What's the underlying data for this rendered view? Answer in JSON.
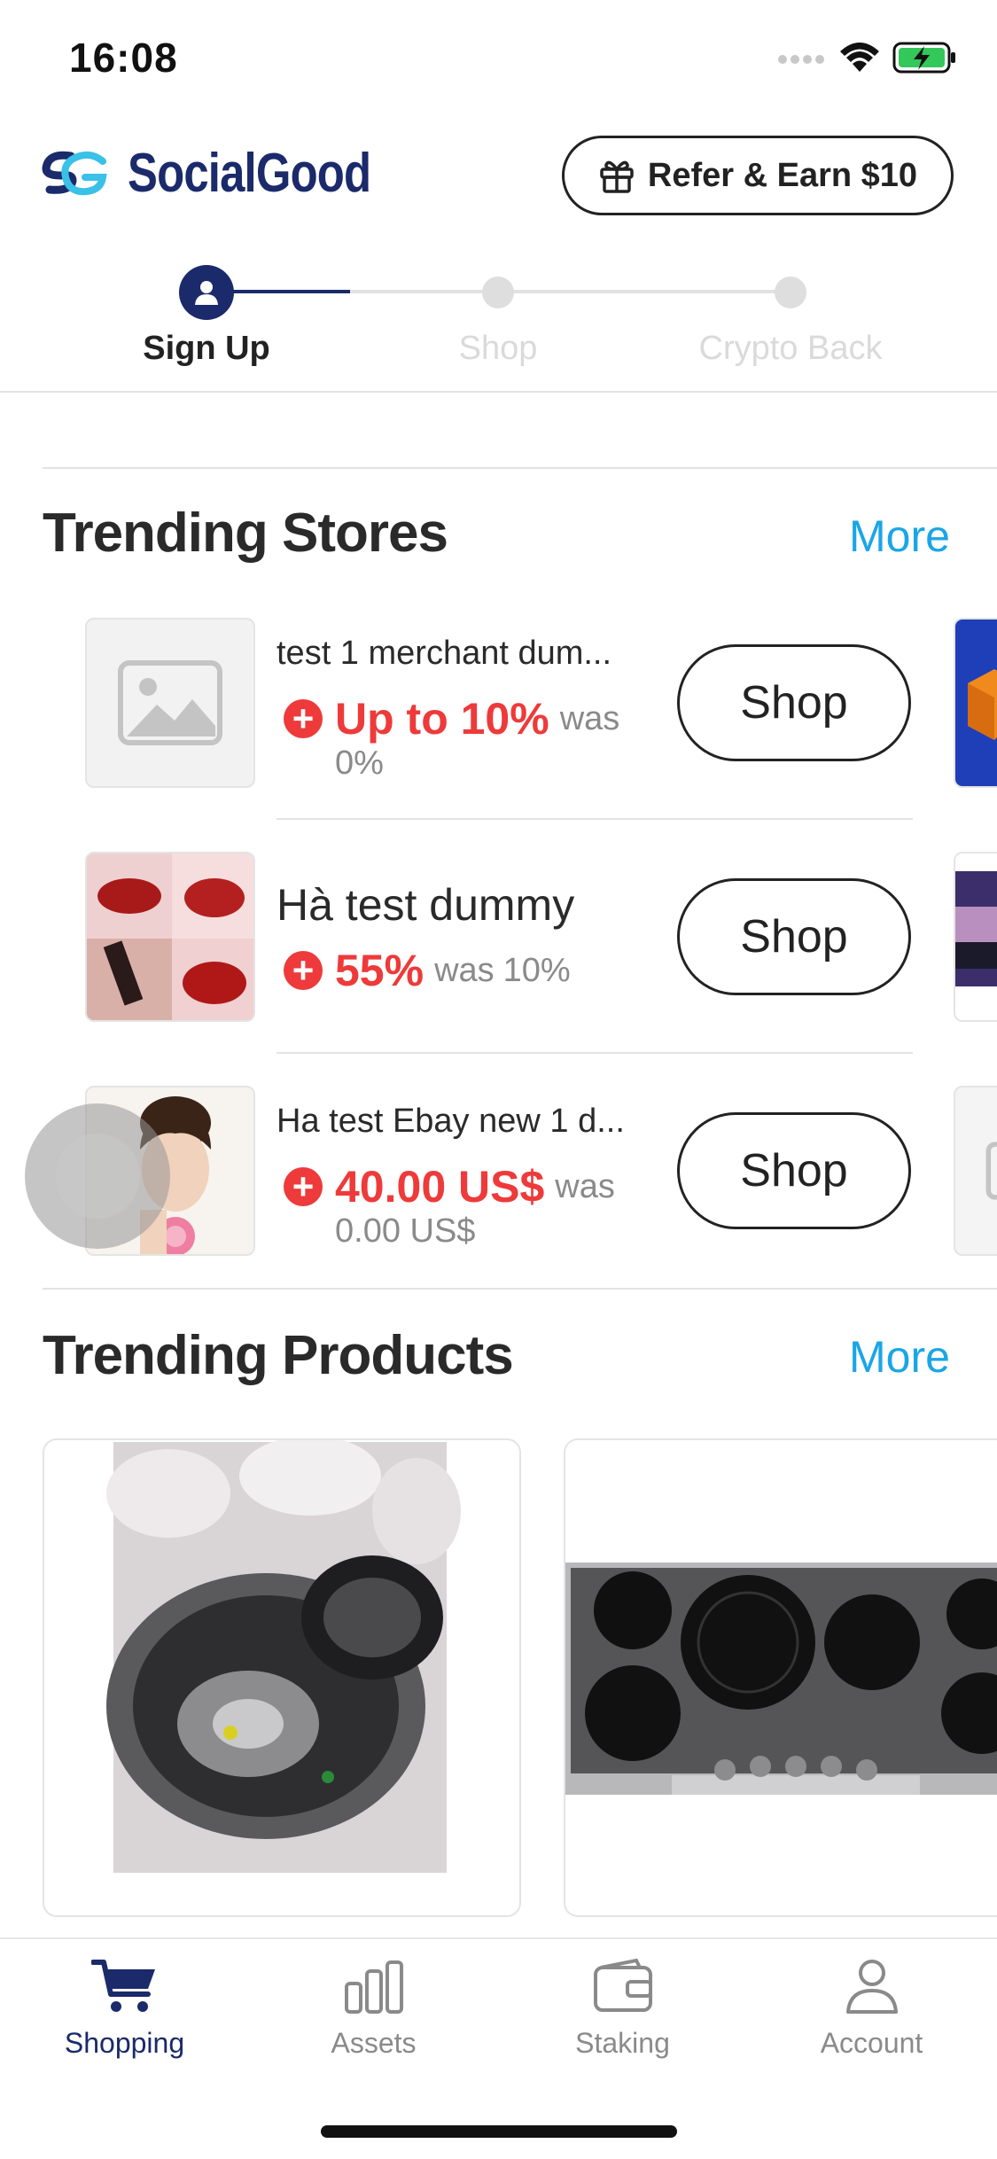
{
  "status_bar": {
    "time": "16:08"
  },
  "header": {
    "brand": "SocialGood",
    "refer_button": "Refer & Earn $10"
  },
  "stepper": {
    "steps": [
      {
        "label": "Sign Up",
        "state": "active"
      },
      {
        "label": "Shop",
        "state": "pending"
      },
      {
        "label": "Crypto Back",
        "state": "pending"
      }
    ]
  },
  "trending_stores": {
    "title": "Trending Stores",
    "more": "More",
    "stores": [
      {
        "name": "test 1 merchant dum...",
        "cashback": "Up to 10%",
        "was_label": "was",
        "was_value": "0%",
        "shop_label": "Shop"
      },
      {
        "name": "Hà test dummy",
        "cashback": "55%",
        "was_label": "was",
        "was_value": "10%",
        "shop_label": "Shop"
      },
      {
        "name": "Ha test Ebay new 1 d...",
        "cashback": "40.00 US$",
        "was_label": "was",
        "was_value": "0.00 US$",
        "shop_label": "Shop"
      }
    ]
  },
  "trending_products": {
    "title": "Trending Products",
    "more": "More"
  },
  "tab_bar": {
    "tabs": [
      {
        "label": "Shopping",
        "icon": "cart-icon",
        "active": true
      },
      {
        "label": "Assets",
        "icon": "bar-chart-icon",
        "active": false
      },
      {
        "label": "Staking",
        "icon": "wallet-icon",
        "active": false
      },
      {
        "label": "Account",
        "icon": "person-icon",
        "active": false
      }
    ]
  },
  "colors": {
    "brand_navy": "#1b2a6b",
    "brand_cyan": "#1aa6e6",
    "cashback_red": "#ee3a3a"
  }
}
